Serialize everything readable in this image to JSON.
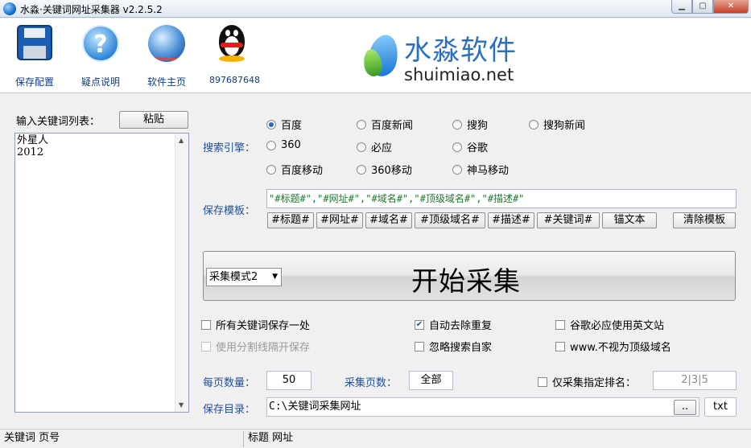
{
  "window": {
    "title": "水淼·关键词网址采集器  v2.2.5.2"
  },
  "toolbar": {
    "save_config": "保存配置",
    "help": "疑点说明",
    "homepage": "软件主页",
    "qq": "897687648"
  },
  "brand": {
    "name_cn": "水淼软件",
    "name_en": "shuimiao.net"
  },
  "keywords": {
    "label": "输入关键词列表：",
    "paste_button": "粘贴",
    "lines": [
      "外星人",
      "2012"
    ]
  },
  "engines": {
    "label": "搜索引擎：",
    "options": [
      "百度",
      "百度新闻",
      "搜狗",
      "搜狗新闻",
      "360",
      "必应",
      "谷歌",
      "百度移动",
      "360移动",
      "神马移动"
    ],
    "selected": "百度"
  },
  "template": {
    "label": "保存模板：",
    "value": "\"#标题#\",\"#网址#\",\"#域名#\",\"#顶级域名#\",\"#描述#\"",
    "buttons": [
      "#标题#",
      "#网址#",
      "#域名#",
      "#顶级域名#",
      "#描述#",
      "#关键词#",
      "锚文本"
    ],
    "clear_button": "清除模板"
  },
  "collect": {
    "mode": "采集模式2",
    "start_button": "开始采集"
  },
  "options": {
    "save_all_in_one": "所有关键词保存一处",
    "use_separator": "使用分割线隔开保存",
    "auto_dedup": "自动去除重复",
    "ignore_own_engine": "忽略搜索自家",
    "google_bing_english": "谷歌必应使用英文站",
    "www_not_top": "www.不视为顶级域名"
  },
  "paging": {
    "per_page_label": "每页数量：",
    "per_page_value": "50",
    "pages_label": "采集页数：",
    "pages_value": "全部",
    "rank_only_label": "仅采集指定排名：",
    "rank_value": "2|3|5"
  },
  "output": {
    "dir_label": "保存目录：",
    "dir_value": "C:\\关键词采集网址",
    "browse_button": "..",
    "format_button": "txt"
  },
  "status": {
    "left": "关键词  页号",
    "right": "标题  网址"
  },
  "colors": {
    "label_blue": "#1d4f9c",
    "template_green": "#1d7a2d",
    "brand_blue": "#2a6fc0"
  }
}
